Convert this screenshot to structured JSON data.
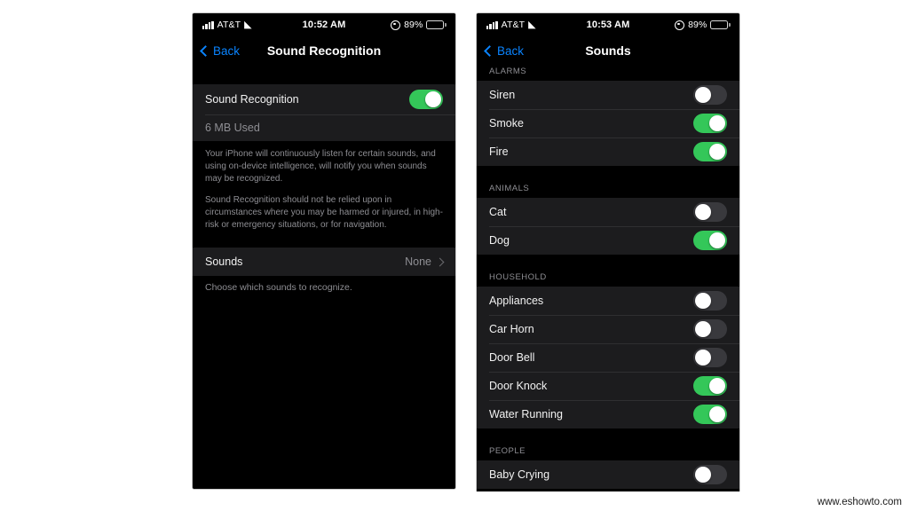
{
  "watermark": "www.eshowto.com",
  "colors": {
    "accent_blue": "#0a84ff",
    "toggle_on_green": "#34c759",
    "toggle_off_gray": "#39393d",
    "row_bg": "#1c1c1e",
    "screen_bg": "#000000",
    "secondary_text": "#8e8e93"
  },
  "left_phone": {
    "status_bar": {
      "carrier": "AT&T",
      "signal_icon": "signal-bars-icon",
      "wifi_icon": "wifi-icon",
      "time": "10:52 AM",
      "dnd_icon": "do-not-disturb-icon",
      "battery_percent": "89%",
      "battery_icon": "battery-icon"
    },
    "nav": {
      "back_label": "Back",
      "back_icon": "chevron-left-icon",
      "title": "Sound Recognition"
    },
    "main_toggle": {
      "label": "Sound Recognition",
      "state": "on"
    },
    "storage_row": {
      "label": "6 MB Used"
    },
    "footnote": [
      "Your iPhone will continuously listen for certain sounds, and using on-device intelligence, will notify you when sounds may be recognized.",
      "Sound Recognition should not be relied upon in circumstances where you may be harmed or injured, in high-risk or emergency situations, or for navigation."
    ],
    "sounds_row": {
      "label": "Sounds",
      "value": "None",
      "chevron_icon": "chevron-right-icon"
    },
    "sounds_caption": "Choose which sounds to recognize."
  },
  "right_phone": {
    "status_bar": {
      "carrier": "AT&T",
      "signal_icon": "signal-bars-icon",
      "wifi_icon": "wifi-icon",
      "time": "10:53 AM",
      "dnd_icon": "do-not-disturb-icon",
      "battery_percent": "89%",
      "battery_icon": "battery-icon"
    },
    "nav": {
      "back_label": "Back",
      "back_icon": "chevron-left-icon",
      "title": "Sounds"
    },
    "sections": [
      {
        "header": "ALARMS",
        "rows": [
          {
            "label": "Siren",
            "state": "off"
          },
          {
            "label": "Smoke",
            "state": "on"
          },
          {
            "label": "Fire",
            "state": "on"
          }
        ]
      },
      {
        "header": "ANIMALS",
        "rows": [
          {
            "label": "Cat",
            "state": "off"
          },
          {
            "label": "Dog",
            "state": "on"
          }
        ]
      },
      {
        "header": "HOUSEHOLD",
        "rows": [
          {
            "label": "Appliances",
            "state": "off"
          },
          {
            "label": "Car Horn",
            "state": "off"
          },
          {
            "label": "Door Bell",
            "state": "off"
          },
          {
            "label": "Door Knock",
            "state": "on"
          },
          {
            "label": "Water Running",
            "state": "on"
          }
        ]
      },
      {
        "header": "PEOPLE",
        "rows": [
          {
            "label": "Baby Crying",
            "state": "off"
          }
        ]
      }
    ]
  }
}
